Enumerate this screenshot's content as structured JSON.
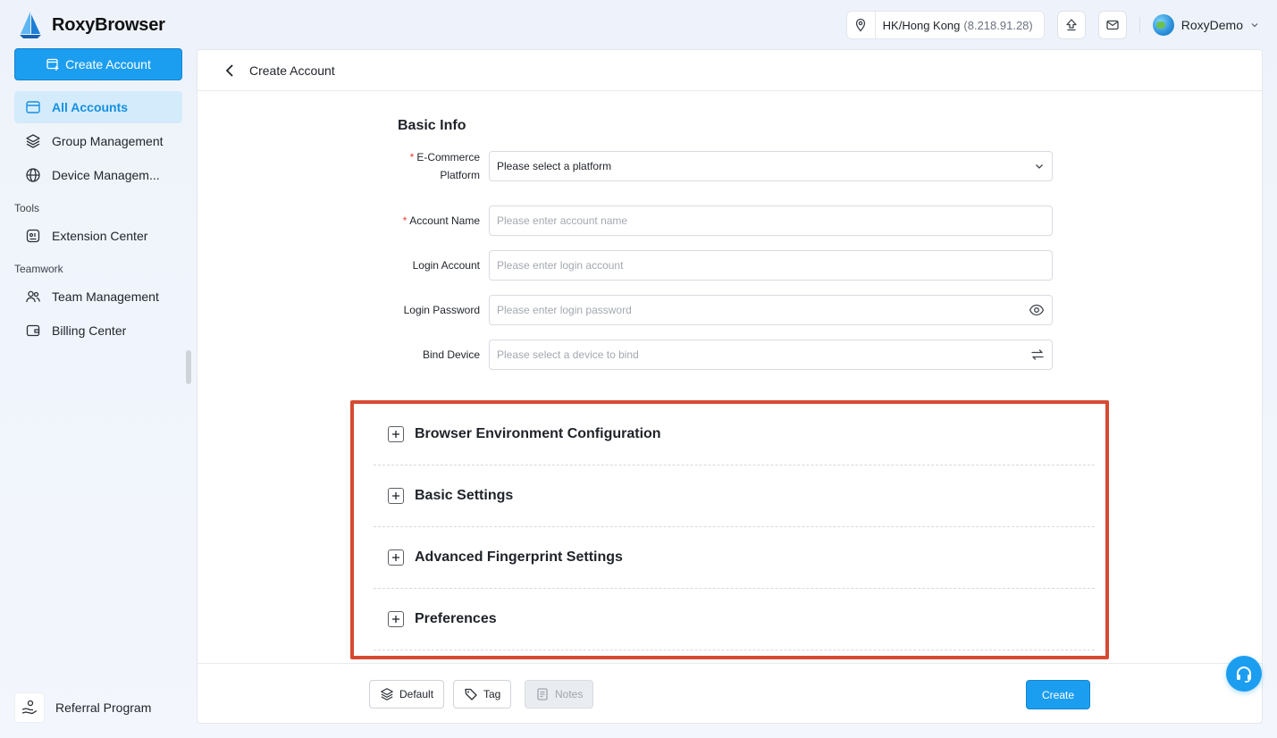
{
  "app": {
    "name": "RoxyBrowser"
  },
  "topbar": {
    "location": "HK/Hong Kong",
    "ip": "(8.218.91.28)",
    "user": "RoxyDemo",
    "icons": {
      "location": "map-pin-icon",
      "upload": "upload-icon",
      "mail": "mail-icon",
      "chevron": "chevron-down-icon"
    }
  },
  "sidebar": {
    "create_button": "Create Account",
    "items": [
      {
        "label": "All Accounts",
        "icon": "window-icon",
        "active": true
      },
      {
        "label": "Group Management",
        "icon": "layers-icon"
      },
      {
        "label": "Device Managem...",
        "icon": "globe-icon"
      }
    ],
    "tools_label": "Tools",
    "tools": [
      {
        "label": "Extension Center",
        "icon": "extension-icon"
      }
    ],
    "teamwork_label": "Teamwork",
    "teamwork": [
      {
        "label": "Team Management",
        "icon": "users-icon"
      },
      {
        "label": "Billing Center",
        "icon": "wallet-icon"
      }
    ],
    "referral": "Referral Program"
  },
  "page": {
    "title": "Create Account",
    "section": "Basic Info",
    "fields": {
      "platform": {
        "label_1": "E-Commerce",
        "label_2": "Platform",
        "value": "Please select a platform",
        "required": true
      },
      "account_name": {
        "label": "Account Name",
        "placeholder": "Please enter account name",
        "required": true
      },
      "login_account": {
        "label": "Login Account",
        "placeholder": "Please enter login account"
      },
      "login_password": {
        "label": "Login Password",
        "placeholder": "Please enter login password"
      },
      "bind_device": {
        "label": "Bind Device",
        "placeholder": "Please select a device to bind"
      }
    },
    "collapse": [
      "Browser Environment Configuration",
      "Basic Settings",
      "Advanced Fingerprint Settings",
      "Preferences"
    ],
    "footer": {
      "default": "Default",
      "tag": "Tag",
      "notes": "Notes",
      "create": "Create"
    }
  },
  "colors": {
    "accent": "#1c9ef0",
    "highlight_border": "#d64a32",
    "active_bg": "#d4ebfb"
  }
}
